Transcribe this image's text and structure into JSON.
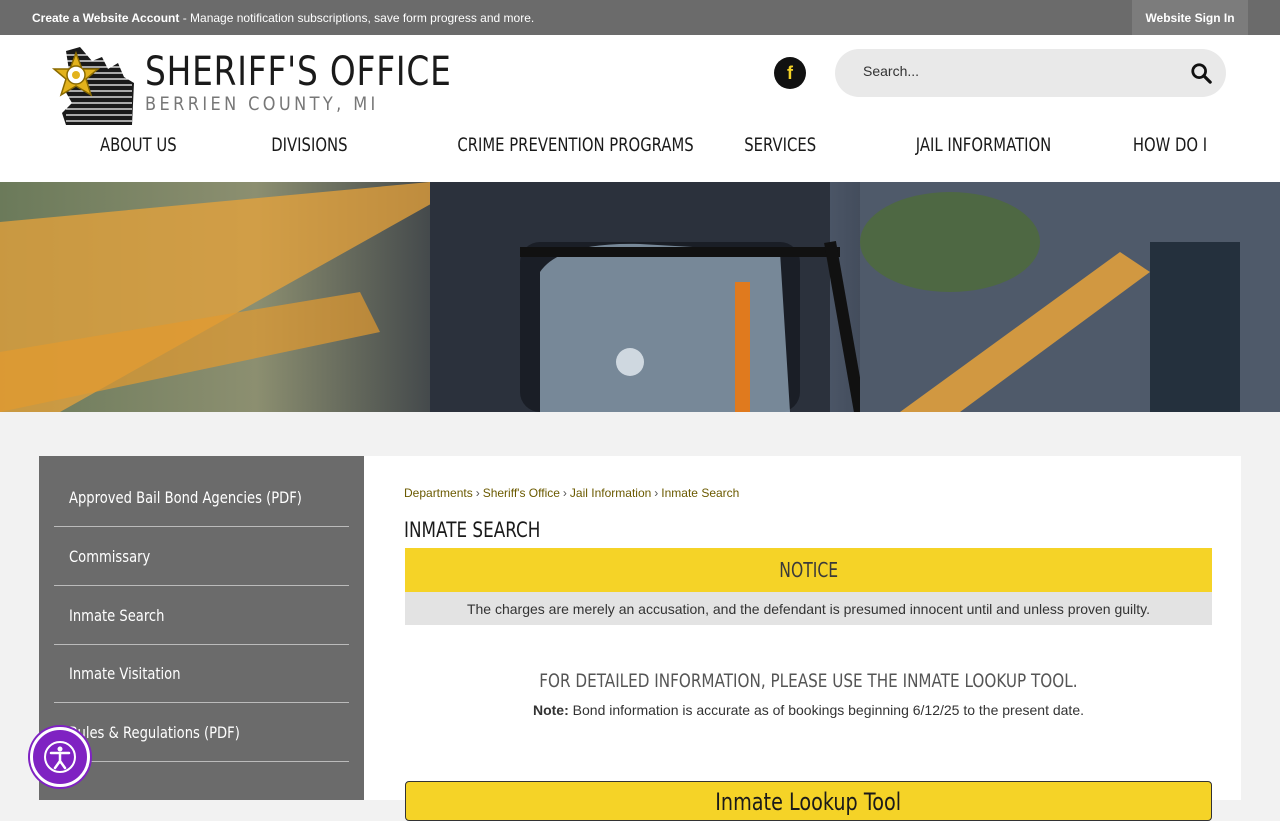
{
  "topbar": {
    "create_account": "Create a Website Account",
    "message": " - Manage notification subscriptions, save form progress and more.",
    "sign_in": "Website Sign In"
  },
  "header": {
    "title": "SHERIFF'S OFFICE",
    "subtitle": "BERRIEN COUNTY, MI",
    "facebook_icon": "facebook-icon",
    "search_placeholder": "Search..."
  },
  "nav": {
    "items": [
      "About Us",
      "Divisions",
      "Crime Prevention Programs",
      "Services",
      "Jail Information",
      "How Do I"
    ]
  },
  "sidebar": {
    "items": [
      "Approved Bail Bond Agencies (PDF)",
      "Commissary",
      "Inmate Search",
      "Inmate Visitation",
      "Rules & Regulations (PDF)"
    ]
  },
  "breadcrumb": [
    "Departments",
    "Sheriff's Office",
    "Jail Information",
    "Inmate Search"
  ],
  "main": {
    "title": "INMATE SEARCH",
    "notice_heading": "NOTICE",
    "notice_text": "The charges are merely an accusation, and the defendant is presumed innocent until and unless proven guilty.",
    "lookup_heading": "FOR DETAILED INFORMATION, PLEASE USE THE INMATE LOOKUP TOOL.",
    "note_label": "Note:",
    "note_text": " Bond information is accurate as of bookings beginning 6/12/25 to the present date.",
    "lookup_button": "Inmate Lookup Tool"
  },
  "colors": {
    "accent_yellow": "#f5d327",
    "topbar_gray": "#6b6b6b",
    "sidebar_gray": "#6b6b6b",
    "a11y_purple": "#7f22c2"
  }
}
